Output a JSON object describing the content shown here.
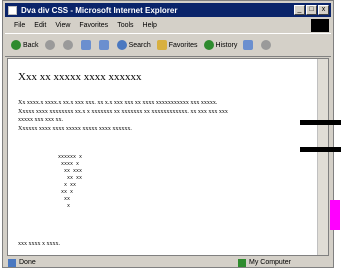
{
  "window": {
    "title": "Dva div CSS - Microsoft Internet Explorer",
    "controls": {
      "minimize": "_",
      "maximize": "□",
      "close": "x"
    }
  },
  "menu": {
    "items": [
      "File",
      "Edit",
      "View",
      "Favorites",
      "Tools",
      "Help"
    ]
  },
  "toolbar": {
    "back": "Back",
    "search": "Search",
    "favorites": "Favorites",
    "history": "History"
  },
  "content": {
    "heading": "Xxx xx xxxxx xxxx xxxxxx",
    "paragraph_lines": [
      "Xx xxxx.x xxxx.x xx.x xxx xxx. xx x.x xxx xxx xx xxxx xxxxxxxxxxx xxx xxxxx.",
      "Xxxxx xxxx xxxxxxxx xx.x x xxxxxxx xx xxxxxxx xx xxxxxxxxxxxx. xx xxx xxx xxx",
      "xxxxx xxx xxx xx.",
      "Xxxxxx xxxx xxxx xxxxx xxxxx xxxx xxxxxx."
    ],
    "preformatted": "xxxxxx x\n xxxx x\n  xx xxx\n   xx xx\n  x xx\n xx x\n  xx\n   x",
    "footer": "xxx xxxx x xxxx."
  },
  "status": {
    "left": "Done",
    "right": "My Computer"
  },
  "colors": {
    "title_bar": "#0a246a",
    "window_chrome": "#d4d0c8",
    "overlay_bar": "#000000",
    "overlay_accent": "#ff00ff"
  }
}
